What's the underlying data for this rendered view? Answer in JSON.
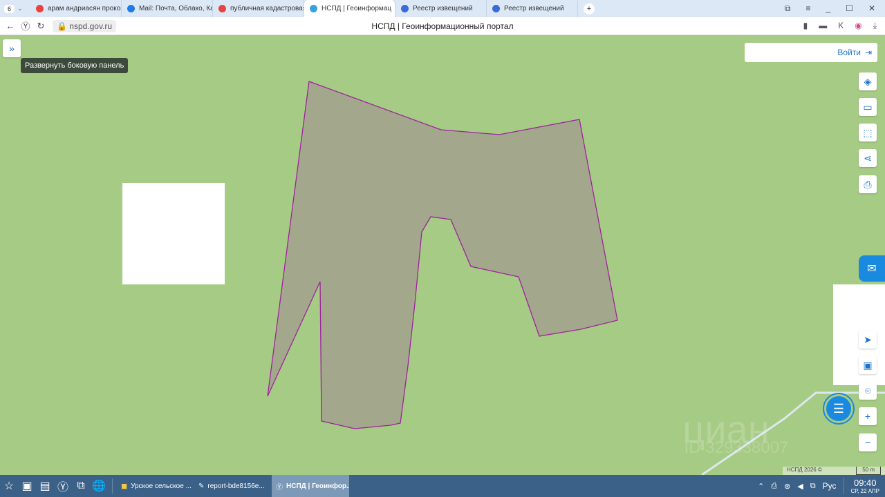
{
  "browser": {
    "tab_count": "6",
    "tabs": [
      {
        "label": "арам андриасян прокоп",
        "icon": "yandex-icon",
        "color": "#e8433d"
      },
      {
        "label": "Mail: Почта, Облако, Кал",
        "icon": "mail-icon",
        "color": "#1f7ce8"
      },
      {
        "label": "публичная кадастровая",
        "icon": "yandex-icon",
        "color": "#e8433d"
      },
      {
        "label": "НСПД | Геоинформац",
        "icon": "nspd-icon",
        "color": "#3aa0e0"
      },
      {
        "label": "Реестр извещений",
        "icon": "emblem-icon",
        "color": "#3a6ad8"
      },
      {
        "label": "Реестр извещений",
        "icon": "emblem-icon",
        "color": "#3a6ad8"
      }
    ],
    "url": "nspd.gov.ru",
    "page_title": "НСПД | Геоинформационный портал"
  },
  "map": {
    "expand_tooltip": "Развернуть боковую панель",
    "login_label": "Войти",
    "attribution": "НСПД 2026 ©",
    "scale": "50 m",
    "watermark": {
      "brand": "циан",
      "id": "ID 329338007"
    },
    "colors": {
      "background": "#a6cb85",
      "parcel_fill": "#a3a78b",
      "parcel_stroke": "#a020a0",
      "accent": "#1a73c8"
    }
  },
  "taskbar": {
    "windows": [
      {
        "label": "Урское сельское ..."
      },
      {
        "label": "report-bde8156e..."
      },
      {
        "label": "НСПД | Геоинфор..."
      }
    ],
    "lang": "Рус",
    "time": "09:40",
    "date": "СР, 22 АПР"
  }
}
